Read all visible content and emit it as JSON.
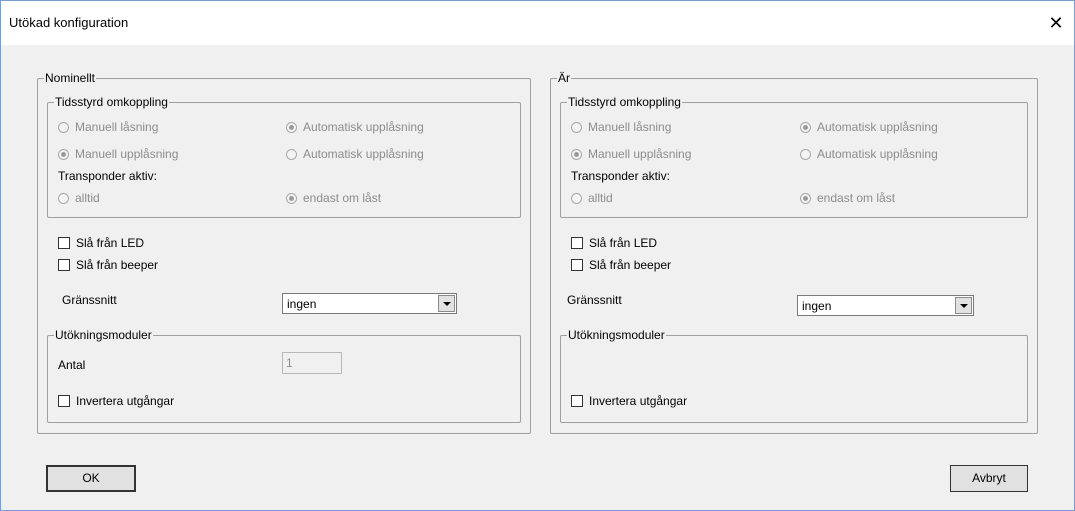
{
  "window": {
    "title": "Utökad konfiguration",
    "close_label": "✕"
  },
  "panels": [
    {
      "title": "Nominellt",
      "timed_group": {
        "title": "Tidsstyrd omkoppling",
        "options": [
          "Manuell låsning",
          "Automatisk upplåsning",
          "Manuell upplåsning",
          "Automatisk upplåsning"
        ],
        "transponder_label": "Transponder aktiv:",
        "transponder_options": [
          "alltid",
          "endast om låst"
        ]
      },
      "disable_led": "Slå från LED",
      "disable_beeper": "Slå från beeper",
      "interface_label": "Gränssnitt",
      "interface_value": "ingen",
      "ext_group": {
        "title": "Utökningsmoduler",
        "count_label": "Antal",
        "count_value": "1",
        "invert_label": "Invertera utgångar"
      }
    },
    {
      "title": "Är",
      "timed_group": {
        "title": "Tidsstyrd omkoppling",
        "options": [
          "Manuell låsning",
          "Automatisk upplåsning",
          "Manuell upplåsning",
          "Automatisk upplåsning"
        ],
        "transponder_label": "Transponder aktiv:",
        "transponder_options": [
          "alltid",
          "endast om låst"
        ]
      },
      "disable_led": "Slå från LED",
      "disable_beeper": "Slå från beeper",
      "interface_label": "Gränssnitt",
      "interface_value": "ingen",
      "ext_group": {
        "title": "Utökningsmoduler",
        "invert_label": "Invertera utgångar"
      }
    }
  ],
  "buttons": {
    "ok": "OK",
    "cancel": "Avbryt"
  }
}
